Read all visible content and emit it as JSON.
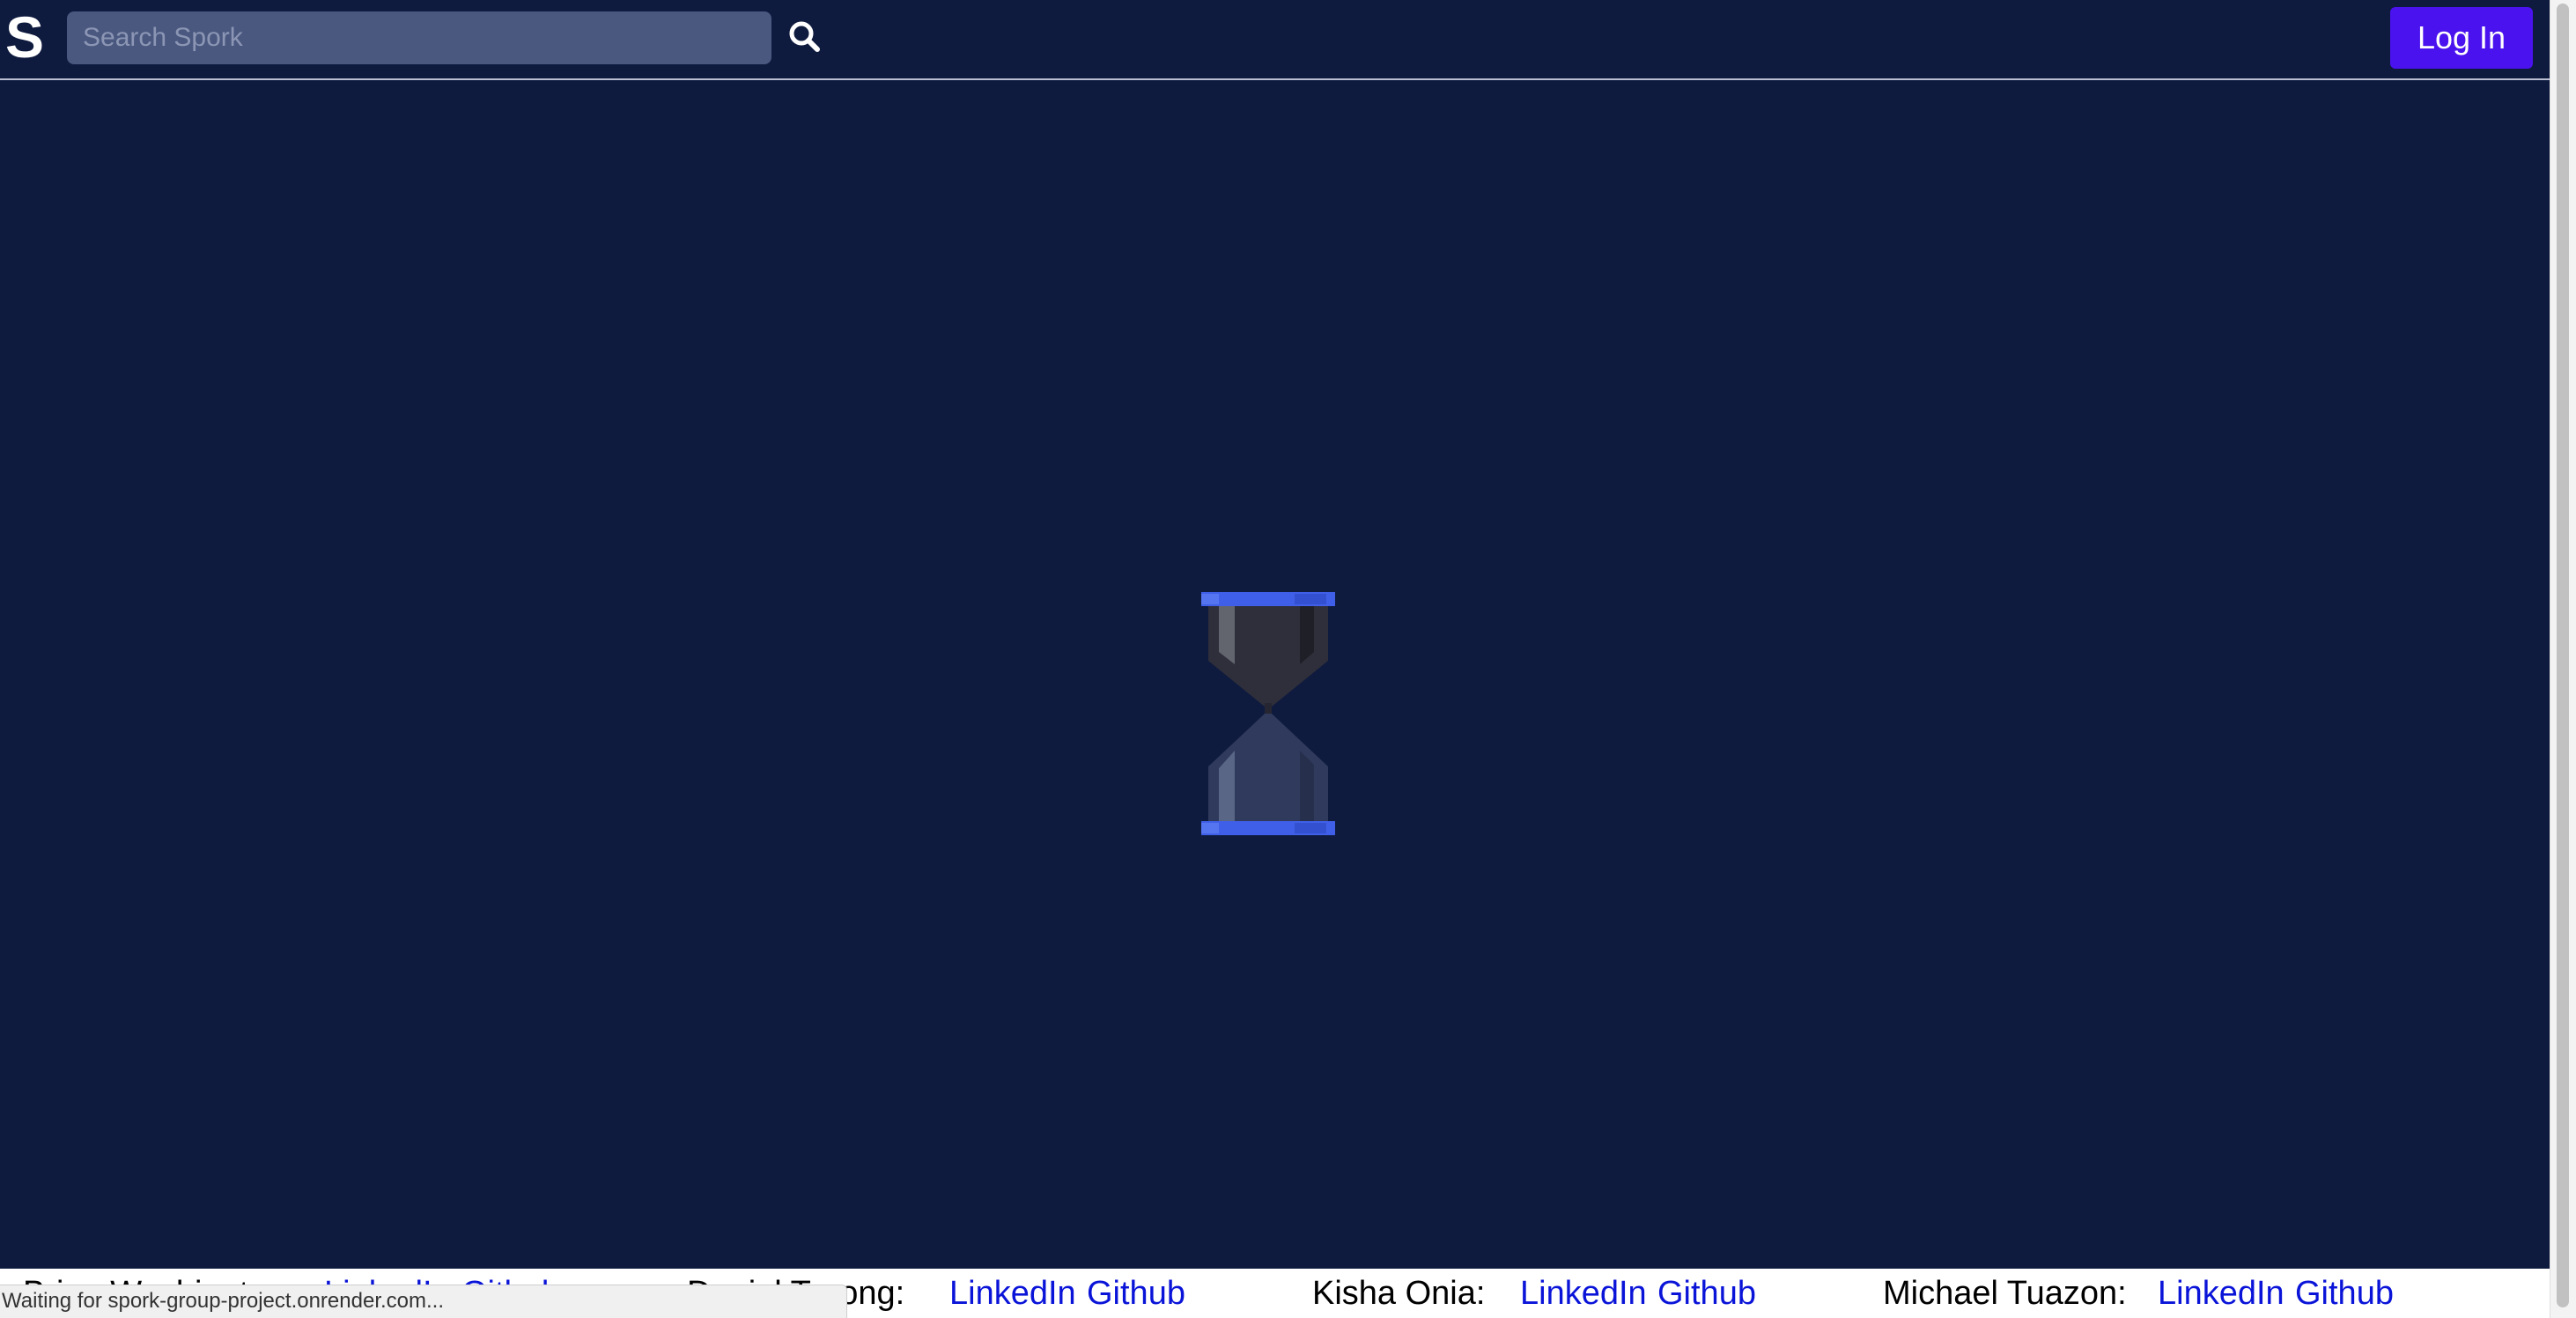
{
  "navbar": {
    "logo_text": "S",
    "search_placeholder": "Search Spork",
    "search_icon": "search-icon",
    "login_label": "Log In"
  },
  "loader": {
    "icon": "hourglass-icon"
  },
  "footer": {
    "members": [
      {
        "name": "Brian Washington:",
        "linkedin": "LinkedIn",
        "github": "Github"
      },
      {
        "name": "Daniel Truong:",
        "linkedin": "LinkedIn",
        "github": "Github"
      },
      {
        "name": "Kisha Onia:",
        "linkedin": "LinkedIn",
        "github": "Github"
      },
      {
        "name": "Michael Tuazon:",
        "linkedin": "LinkedIn",
        "github": "Github"
      }
    ]
  },
  "status_bar": {
    "text": "Waiting for spork-group-project.onrender.com..."
  },
  "colors": {
    "background": "#0e1a3e",
    "accent": "#4a12ee",
    "link": "#0a14d8",
    "hourglass_cap": "#3f5fe8"
  }
}
